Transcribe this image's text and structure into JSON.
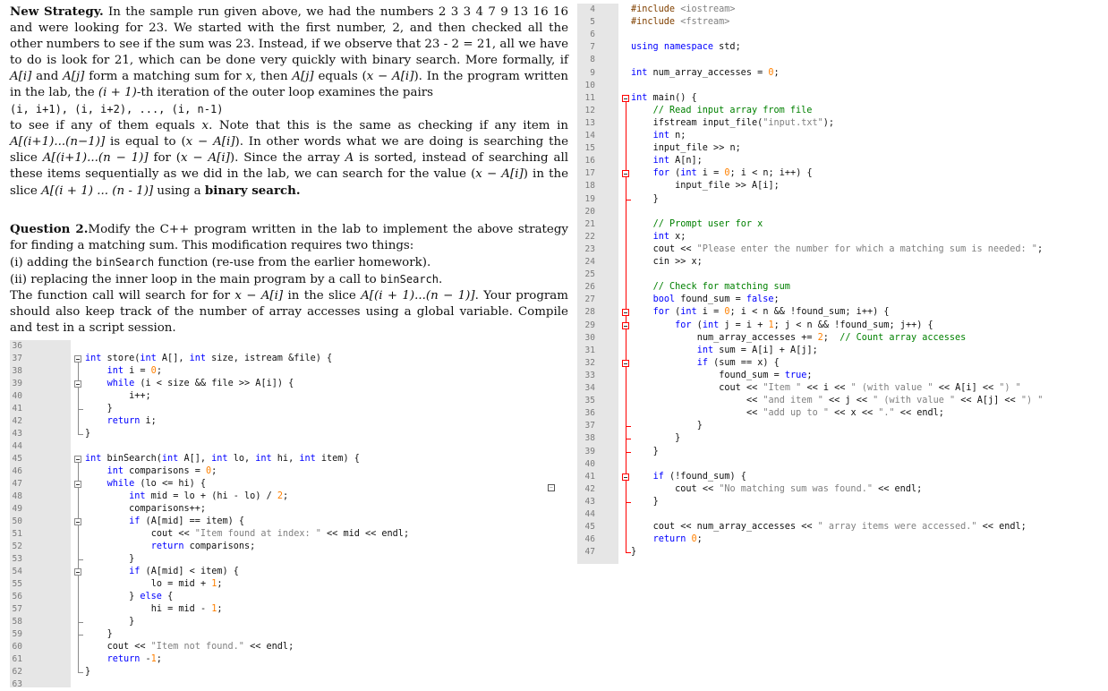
{
  "doc": {
    "p1_title": "New Strategy.",
    "p1_a": " In the sample run given above, we had the numbers 2 3 3 4 7 9 13 16 16 and were looking for 23. We started with the first number, 2, and then checked all the other numbers to see if the sum was 23. Instead, if we observe that 23 - 2 = 21, all we have to do is look for 21, which can be done very quickly with binary search. More formally, if ",
    "p1_b": "A[i]",
    "p1_c": " and ",
    "p1_d": "A[j]",
    "p1_e": " form a matching sum for ",
    "p1_f": "x",
    "p1_g": ", then ",
    "p1_h": "A[j]",
    "p1_i": " equals (",
    "p1_j": "x − A[i]",
    "p1_k": "). In the program written in the lab, the ",
    "p1_l": "(i + 1)",
    "p1_m": "-th iteration of the outer loop examines the pairs",
    "p1_pairs": "(i, i+1), (i, i+2), ..., (i, n-1)",
    "p1_n": "to see if any of them equals ",
    "p1_o": "x",
    "p1_p": ". Note that this is the same as checking if any item in ",
    "p1_q": "A[(i+1)...(n−1)]",
    "p1_r": " is equal to (",
    "p1_s": "x − A[i]",
    "p1_t": "). In other words what we are doing is searching the slice ",
    "p1_u": "A[(i+1)...(n − 1)]",
    "p1_v": " for (",
    "p1_w": "x − A[i]",
    "p1_x": "). Since the array ",
    "p1_y": "A",
    "p1_z": " is sorted, instead of searching all these items sequentially as we did in the lab, we can search for the value (",
    "p1_aa": "x − A[i]",
    "p1_ab": ") in the slice ",
    "p1_ac": "A[(i + 1) ... (n - 1)]",
    "p1_ad": " using a ",
    "p1_ae": "binary search.",
    "q2_title": "Question 2.",
    "q2_a": "Modify the C++ program written in the lab to implement the above strategy for finding a matching sum. This modification requires two things:",
    "q2_b1": "(i) adding the ",
    "q2_b2": "binSearch",
    "q2_b3": " function (re-use from the earlier homework).",
    "q2_c1": "(ii) replacing the inner loop in the main program by a call to ",
    "q2_c2": "binSearch",
    "q2_c3": ".",
    "q2_d1": "The function call will search for for ",
    "q2_d2": "x − A[i]",
    "q2_d3": " in the slice ",
    "q2_d4": "A[(i + 1)...(n − 1)]",
    "q2_d5": ". Your program should also keep track of the number of array accesses using a global variable. Compile and test in a script session."
  },
  "left_code": {
    "line_numbers": [
      "36",
      "37",
      "38",
      "39",
      "40",
      "41",
      "42",
      "43",
      "44",
      "45",
      "46",
      "47",
      "48",
      "49",
      "50",
      "51",
      "52",
      "53",
      "54",
      "55",
      "56",
      "57",
      "58",
      "59",
      "60",
      "61",
      "62",
      "63"
    ],
    "lines": [
      "",
      "int store(int A[], int size, istream &file) {",
      "    int i = 0;",
      "    while (i < size && file >> A[i]) {",
      "        i++;",
      "    }",
      "    return i;",
      "}",
      "",
      "int binSearch(int A[], int lo, int hi, int item) {",
      "    int comparisons = 0;",
      "    while (lo <= hi) {",
      "        int mid = lo + (hi - lo) / 2;",
      "        comparisons++;",
      "        if (A[mid] == item) {",
      "            cout << \"Item found at index: \" << mid << endl;",
      "            return comparisons;",
      "        }",
      "        if (A[mid] < item) {",
      "            lo = mid + 1;",
      "        } else {",
      "            hi = mid - 1;",
      "        }",
      "    }",
      "    cout << \"Item not found.\" << endl;",
      "    return -1;",
      "}",
      ""
    ]
  },
  "right_code": {
    "line_numbers": [
      "4",
      "5",
      "6",
      "7",
      "8",
      "9",
      "10",
      "11",
      "12",
      "13",
      "14",
      "15",
      "16",
      "17",
      "18",
      "19",
      "20",
      "21",
      "22",
      "23",
      "24",
      "25",
      "26",
      "27",
      "28",
      "29",
      "30",
      "31",
      "32",
      "33",
      "34",
      "35",
      "36",
      "37",
      "38",
      "39",
      "40",
      "41",
      "42",
      "43",
      "44",
      "45",
      "46",
      "47"
    ],
    "lines": [
      "#include <iostream>",
      "#include <fstream>",
      "",
      "using namespace std;",
      "",
      "int num_array_accesses = 0;",
      "",
      "int main() {",
      "    // Read input array from file",
      "    ifstream input_file(\"input.txt\");",
      "    int n;",
      "    input_file >> n;",
      "    int A[n];",
      "    for (int i = 0; i < n; i++) {",
      "        input_file >> A[i];",
      "    }",
      "",
      "    // Prompt user for x",
      "    int x;",
      "    cout << \"Please enter the number for which a matching sum is needed: \";",
      "    cin >> x;",
      "",
      "    // Check for matching sum",
      "    bool found_sum = false;",
      "    for (int i = 0; i < n && !found_sum; i++) {",
      "        for (int j = i + 1; j < n && !found_sum; j++) {",
      "            num_array_accesses += 2;  // Count array accesses",
      "            int sum = A[i] + A[j];",
      "            if (sum == x) {",
      "                found_sum = true;",
      "                cout << \"Item \" << i << \" (with value \" << A[i] << \") \"",
      "                     << \"and item \" << j << \" (with value \" << A[j] << \") \"",
      "                     << \"add up to \" << x << \".\" << endl;",
      "            }",
      "        }",
      "    }",
      "",
      "    if (!found_sum) {",
      "        cout << \"No matching sum was found.\" << endl;",
      "    }",
      "",
      "    cout << num_array_accesses << \" array items were accessed.\" << endl;",
      "    return 0;",
      "}"
    ]
  }
}
